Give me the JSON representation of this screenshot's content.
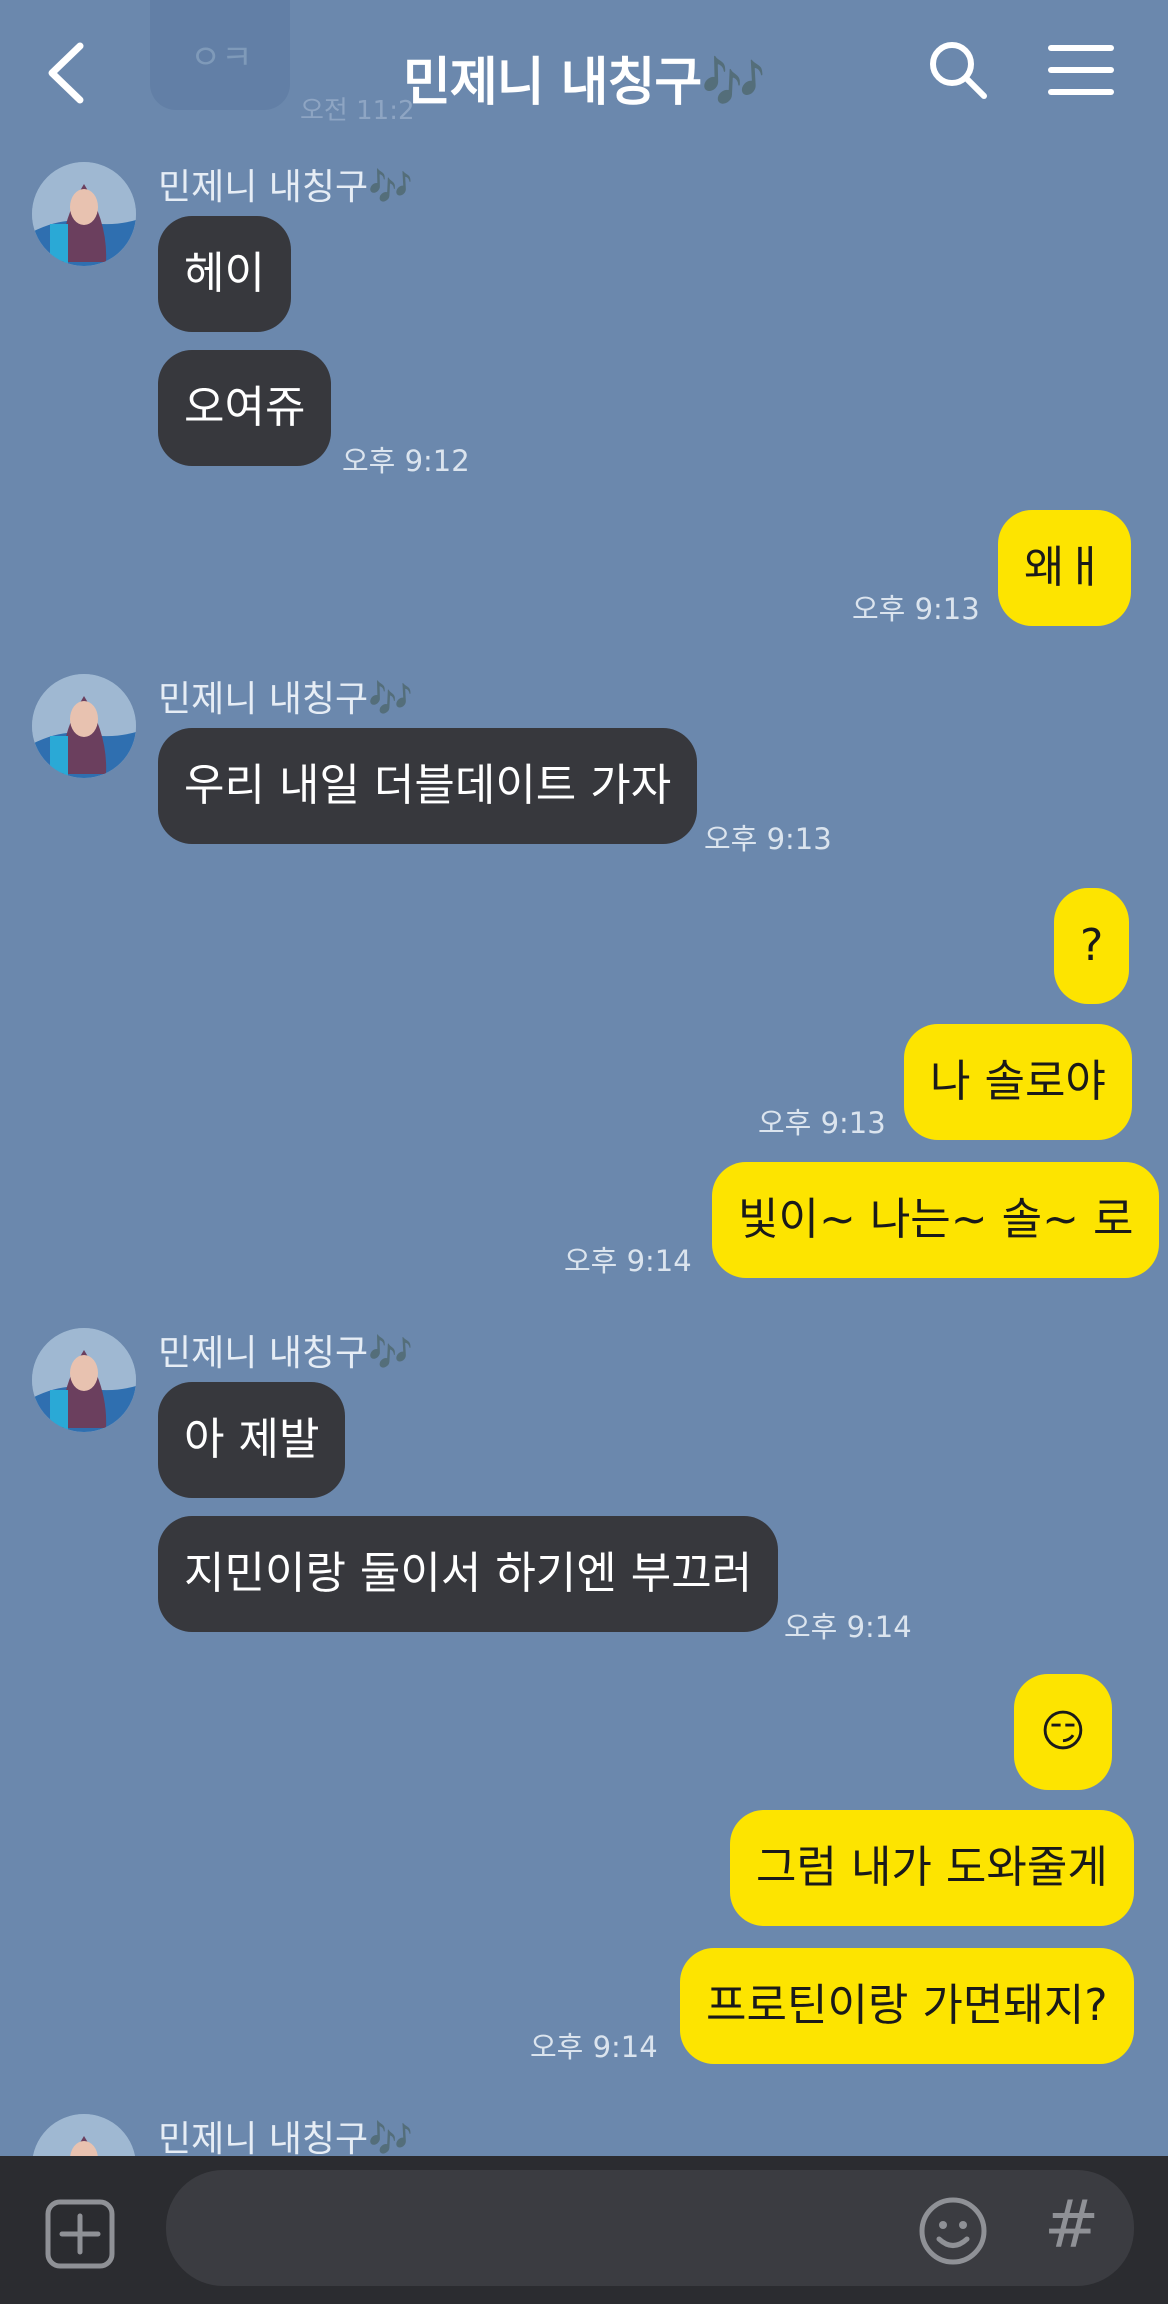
{
  "header": {
    "title": "민제니 내칭구🎶"
  },
  "ghost_top": {
    "text": "ㅇㅋ",
    "time": "오전 11:2"
  },
  "messages": [
    {
      "sender": "민제니 내칭구🎶",
      "text": "헤이",
      "time": ""
    },
    {
      "text": "오여쥬",
      "time": "오후 9:12"
    },
    {
      "text": "왜ㅐ",
      "time": "오후 9:13"
    },
    {
      "sender": "민제니 내칭구🎶",
      "text": "우리 내일 더블데이트 가자",
      "time": "오후 9:13"
    },
    {
      "text": "?",
      "time": ""
    },
    {
      "text": "나 솔로야",
      "time": "오후 9:13"
    },
    {
      "text": "빛이~ 나는~ 솔~ 로",
      "time": "오후 9:14"
    },
    {
      "sender": "민제니 내칭구🎶",
      "text": "아 제발",
      "time": ""
    },
    {
      "text": "지민이랑 둘이서 하기엔 부끄러",
      "time": "오후 9:14"
    },
    {
      "text": "😏",
      "time": ""
    },
    {
      "text": "그럼 내가 도와줄게",
      "time": ""
    },
    {
      "text": "프로틴이랑 가면돼지?",
      "time": "오후 9:14"
    },
    {
      "sender": "민제니 내칭구🎶"
    }
  ],
  "composer": {
    "placeholder": "",
    "hash_label": "#"
  },
  "colors": {
    "background": "#6b88ad",
    "incoming_bubble": "#37383d",
    "outgoing_bubble": "#fde400",
    "composer_bar": "#2b2c30"
  }
}
